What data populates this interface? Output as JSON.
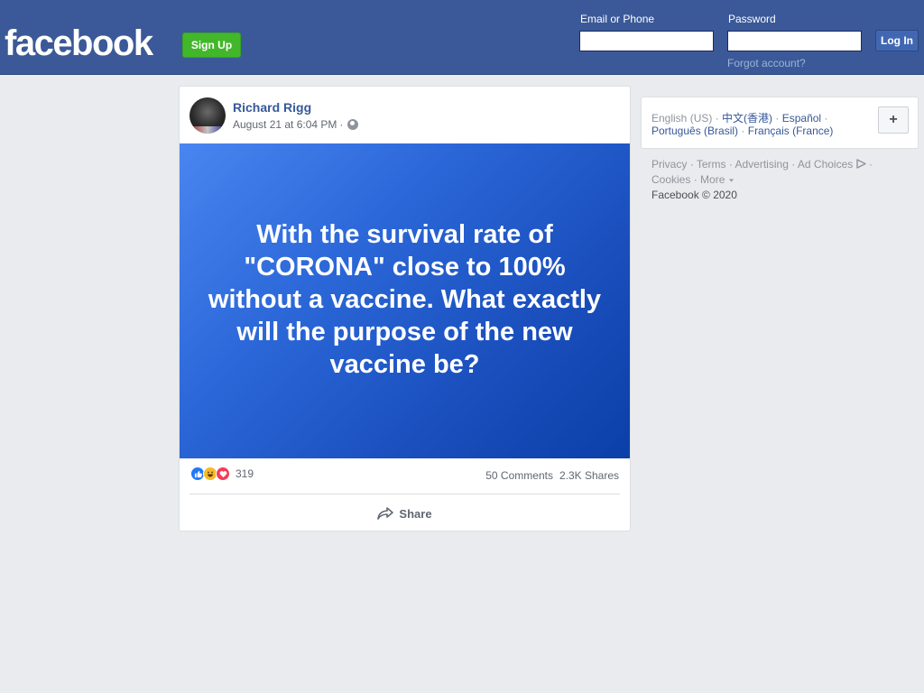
{
  "header": {
    "logo": "facebook",
    "signup_label": "Sign Up",
    "email_label": "Email or Phone",
    "password_label": "Password",
    "login_label": "Log In",
    "forgot_label": "Forgot account?",
    "bg_color": "#3b5998",
    "signup_color": "#42b72a"
  },
  "post": {
    "author": "Richard Rigg",
    "timestamp": "August 21 at 6:04 PM",
    "meta_sep": "·",
    "privacy_icon": "globe-icon",
    "image_text": "With the survival rate of \"CORONA\" close to 100% without a vaccine. What exactly will the purpose of the new vaccine be?",
    "reactions": {
      "icons": [
        "like-icon",
        "haha-icon",
        "love-icon"
      ],
      "count": "319"
    },
    "comments": "50 Comments",
    "shares": "2.3K Shares",
    "share_label": "Share"
  },
  "sidebar": {
    "languages": {
      "current": "English (US)",
      "items": [
        "中文(香港)",
        "Español",
        "Português (Brasil)",
        "Français (France)"
      ],
      "sep": "·",
      "more_label": "+"
    },
    "footer": {
      "links": [
        "Privacy",
        "Terms",
        "Advertising",
        "Ad Choices",
        "Cookies",
        "More"
      ],
      "copyright": "Facebook © 2020"
    }
  }
}
